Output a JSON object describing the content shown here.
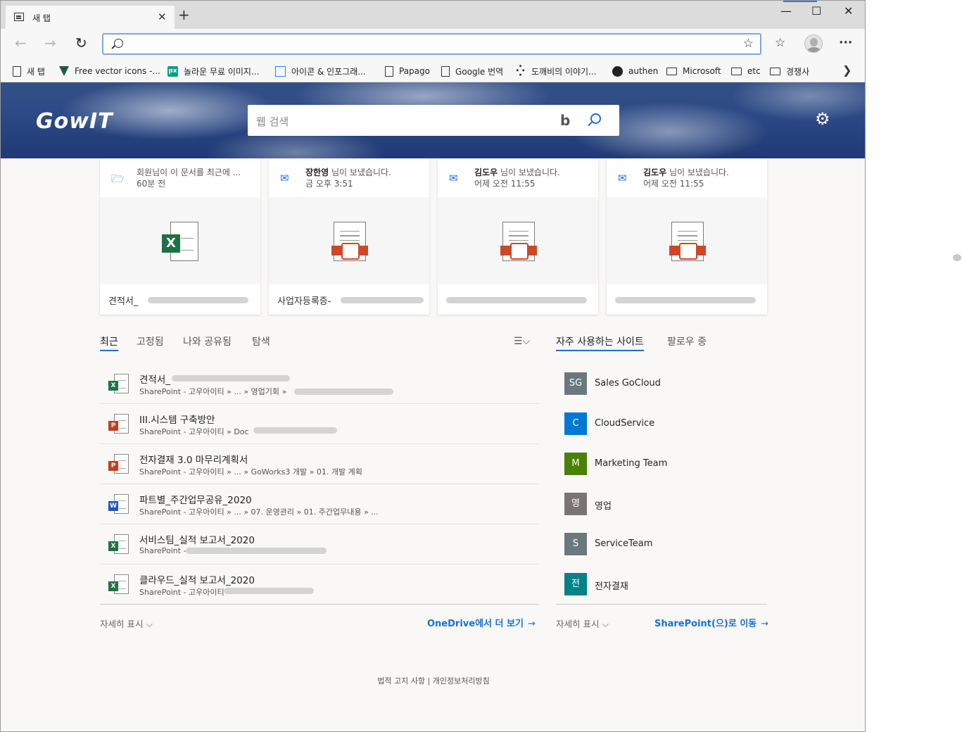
{
  "browser": {
    "tab_title": "새 탭",
    "tab_close": "✕",
    "new_tab": "+",
    "window_controls": {
      "minimize": "—",
      "maximize": "☐",
      "close": "✕"
    },
    "nav": {
      "back": "←",
      "forward": "→",
      "refresh": "↻"
    },
    "address_value": "",
    "more_menu": "···"
  },
  "favorites": [
    {
      "label": "새 탭",
      "icon": "page-icon"
    },
    {
      "label": "Free vector icons -...",
      "icon": "flaticon-icon"
    },
    {
      "label": "놀라운 무료 이미지...",
      "icon": "pexels-icon",
      "glyph": "px"
    },
    {
      "label": "아이콘 & 인포그래...",
      "icon": "square-icon"
    },
    {
      "label": "Papago",
      "icon": "page-icon"
    },
    {
      "label": "Google 번역",
      "icon": "page-icon"
    },
    {
      "label": "도깨비의 이야기...",
      "icon": "dots-icon",
      "glyph": "⁛"
    },
    {
      "label": "authen",
      "icon": "github-icon"
    },
    {
      "label": "Microsoft",
      "icon": "folder-icon"
    },
    {
      "label": "etc",
      "icon": "folder-icon"
    },
    {
      "label": "경쟁사",
      "icon": "folder-icon"
    }
  ],
  "hero": {
    "logo": "GowIT",
    "search_placeholder": "웹 검색",
    "bing_glyph": "b",
    "gear": "⚙"
  },
  "cards": [
    {
      "icon": "folder-open-icon",
      "glyph": "🗁",
      "line1_name": "",
      "line1_rest": "회원님이 이 문서를 최근에 ...",
      "line2": "60분 전",
      "file_type": "excel",
      "file_name": "견적서_"
    },
    {
      "icon": "mail-icon",
      "glyph": "✉",
      "line1_name": "장한영",
      "line1_rest": " 님이 보냈습니다.",
      "line2": "금 오후 3:51",
      "file_type": "pdf",
      "file_name": "사업자등록증-"
    },
    {
      "icon": "mail-icon",
      "glyph": "✉",
      "line1_name": "김도우",
      "line1_rest": " 님이 보냈습니다.",
      "line2": "어제 오전 11:55",
      "file_type": "pdf",
      "file_name": ""
    },
    {
      "icon": "mail-icon",
      "glyph": "✉",
      "line1_name": "김도우",
      "line1_rest": " 님이 보냈습니다.",
      "line2": "어제 오전 11:55",
      "file_type": "pdf",
      "file_name": ""
    }
  ],
  "file_tabs": [
    "최근",
    "고정됨",
    "나와 공유됨",
    "탐색"
  ],
  "sort_glyph": "☰⌵",
  "recent_files": [
    {
      "badge": "X",
      "type": "x",
      "title": "견적서_",
      "path": "SharePoint - 고우아이티 » ... » 영업기회 »"
    },
    {
      "badge": "P",
      "type": "p",
      "title": "III.시스템 구축방안",
      "path": "SharePoint - 고우아이티 » Doc"
    },
    {
      "badge": "P",
      "type": "p",
      "title": "전자결재 3.0 마무리계획서",
      "path": "SharePoint - 고우아이티 » ... » GoWorks3 개발 » 01. 개발 계획"
    },
    {
      "badge": "W",
      "type": "w",
      "title": "파트별_주간업무공유_2020",
      "path": "SharePoint - 고우아이티 » ... » 07. 운영관리 » 01. 주간업무내용 » ..."
    },
    {
      "badge": "X",
      "type": "x",
      "title": "서비스팀_실적 보고서_2020",
      "path": "SharePoint - "
    },
    {
      "badge": "X",
      "type": "x",
      "title": "클라우드_실적 보고서_2020",
      "path": "SharePoint - 고우아이티"
    }
  ],
  "recent_footer": {
    "more": "자세히 표시 ⌵",
    "link": "OneDrive에서 더 보기",
    "arrow": "→"
  },
  "site_tabs": [
    "자주 사용하는 사이트",
    "팔로우 중"
  ],
  "sites": [
    {
      "initials": "SG",
      "name": "Sales GoCloud",
      "color": "#69797e"
    },
    {
      "initials": "C",
      "name": "CloudService",
      "color": "#0078d4"
    },
    {
      "initials": "M",
      "name": "Marketing Team",
      "color": "#498205"
    },
    {
      "initials": "영",
      "name": "영업",
      "color": "#7a7574"
    },
    {
      "initials": "S",
      "name": "ServiceTeam",
      "color": "#69797e"
    },
    {
      "initials": "전",
      "name": "전자결재",
      "color": "#038387"
    }
  ],
  "sites_footer": {
    "more": "자세히 표시 ⌵",
    "link": "SharePoint(으)로 이동",
    "arrow": "→"
  },
  "footer": "법적 고지 사항 | 개인정보처리방침"
}
